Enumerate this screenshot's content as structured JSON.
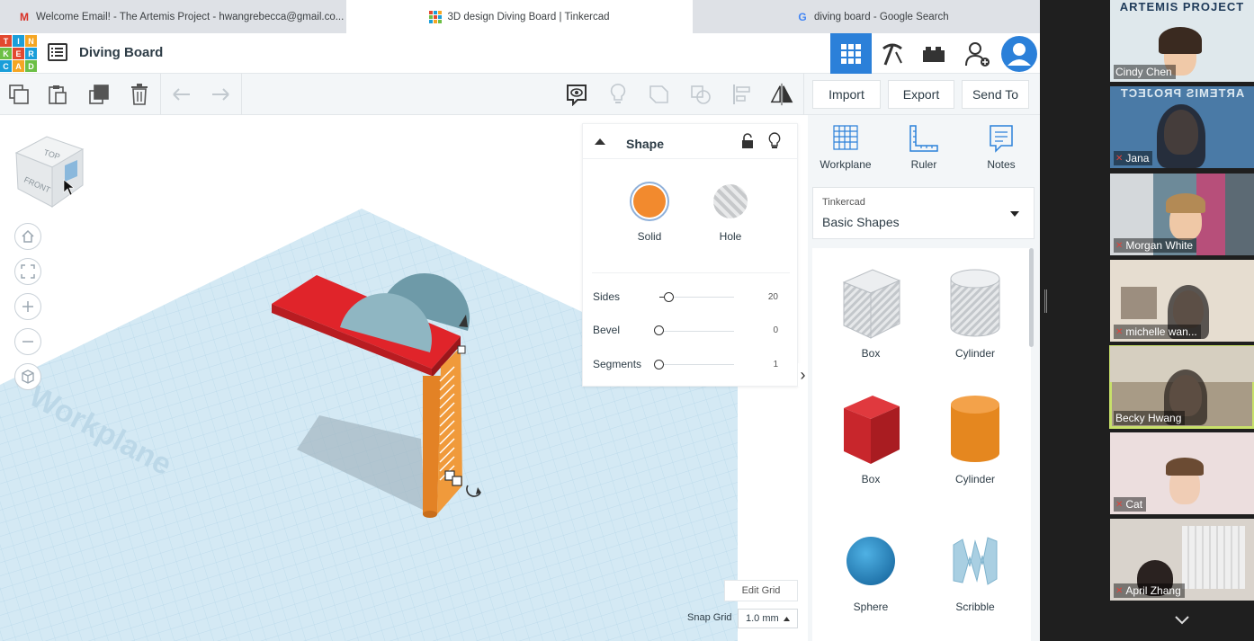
{
  "browser": {
    "tabs": [
      {
        "title": "Welcome Email! - The Artemis Project - hwangrebecca@gmail.co...",
        "icon": "gmail-icon"
      },
      {
        "title": "3D design Diving Board | Tinkercad",
        "icon": "tinkercad-icon"
      },
      {
        "title": "diving board - Google Search",
        "icon": "google-icon"
      }
    ]
  },
  "header": {
    "logo_letters": [
      "TIN",
      "KER",
      "CAD"
    ],
    "design_title": "Diving Board"
  },
  "toolbar": {
    "import_label": "Import",
    "export_label": "Export",
    "send_to_label": "Send To"
  },
  "workplane": {
    "label": "Workplane",
    "view_cube": {
      "top": "TOP",
      "front": "FRONT"
    }
  },
  "inspector": {
    "title": "Shape",
    "solid_label": "Solid",
    "hole_label": "Hole",
    "solid_color": "#f28a2e",
    "props": [
      {
        "label": "Sides",
        "value": "20",
        "fraction": 0.05
      },
      {
        "label": "Bevel",
        "value": "0",
        "fraction": 0.0
      },
      {
        "label": "Segments",
        "value": "1",
        "fraction": 0.0
      }
    ]
  },
  "right_panel": {
    "tools": [
      {
        "label": "Workplane",
        "icon": "workplane-grid-icon"
      },
      {
        "label": "Ruler",
        "icon": "ruler-icon"
      },
      {
        "label": "Notes",
        "icon": "notes-icon"
      }
    ],
    "library": {
      "category": "Tinkercad",
      "name": "Basic Shapes"
    },
    "shapes": [
      {
        "label": "Box",
        "style": "hole"
      },
      {
        "label": "Cylinder",
        "style": "hole"
      },
      {
        "label": "Box",
        "style": "red"
      },
      {
        "label": "Cylinder",
        "style": "orange"
      },
      {
        "label": "Sphere",
        "style": "blue"
      },
      {
        "label": "Scribble",
        "style": "light-blue"
      }
    ]
  },
  "grid": {
    "edit_grid_label": "Edit Grid",
    "snap_label": "Snap Grid",
    "snap_value": "1.0 mm"
  },
  "video": {
    "banner": "ARTEMIS PROJECT",
    "participants": [
      {
        "name": "Cindy Chen",
        "muted": false
      },
      {
        "name": "Jana",
        "muted": true
      },
      {
        "name": "Morgan White",
        "muted": true
      },
      {
        "name": "michelle wan...",
        "muted": true
      },
      {
        "name": "Becky Hwang",
        "muted": false
      },
      {
        "name": "Cat",
        "muted": true
      },
      {
        "name": "April Zhang",
        "muted": true
      }
    ]
  }
}
